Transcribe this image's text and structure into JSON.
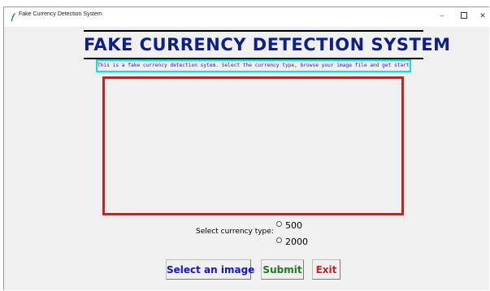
{
  "window": {
    "title": "Fake Currency Detection System",
    "controls": {
      "minimize": "–",
      "close": "✕"
    }
  },
  "main": {
    "heading": "FAKE CURRENCY DETECTION SYSTEM",
    "intro": "This is a fake currency detection sytem. Select the currency type, browse your image file and get started!",
    "currency": {
      "label": "Select currency type:",
      "options": [
        "500",
        "2000"
      ],
      "selected": null
    },
    "buttons": {
      "select_image": "Select an image",
      "submit": "Submit",
      "exit": "Exit"
    }
  },
  "colors": {
    "heading": "#0f1f8a",
    "intro_text": "#1a1acc",
    "intro_border": "#00e5ee",
    "image_border": "#a8312f",
    "select_button": "#1414d4",
    "submit_button": "#1e7a1e",
    "exit_button": "#e01818"
  }
}
